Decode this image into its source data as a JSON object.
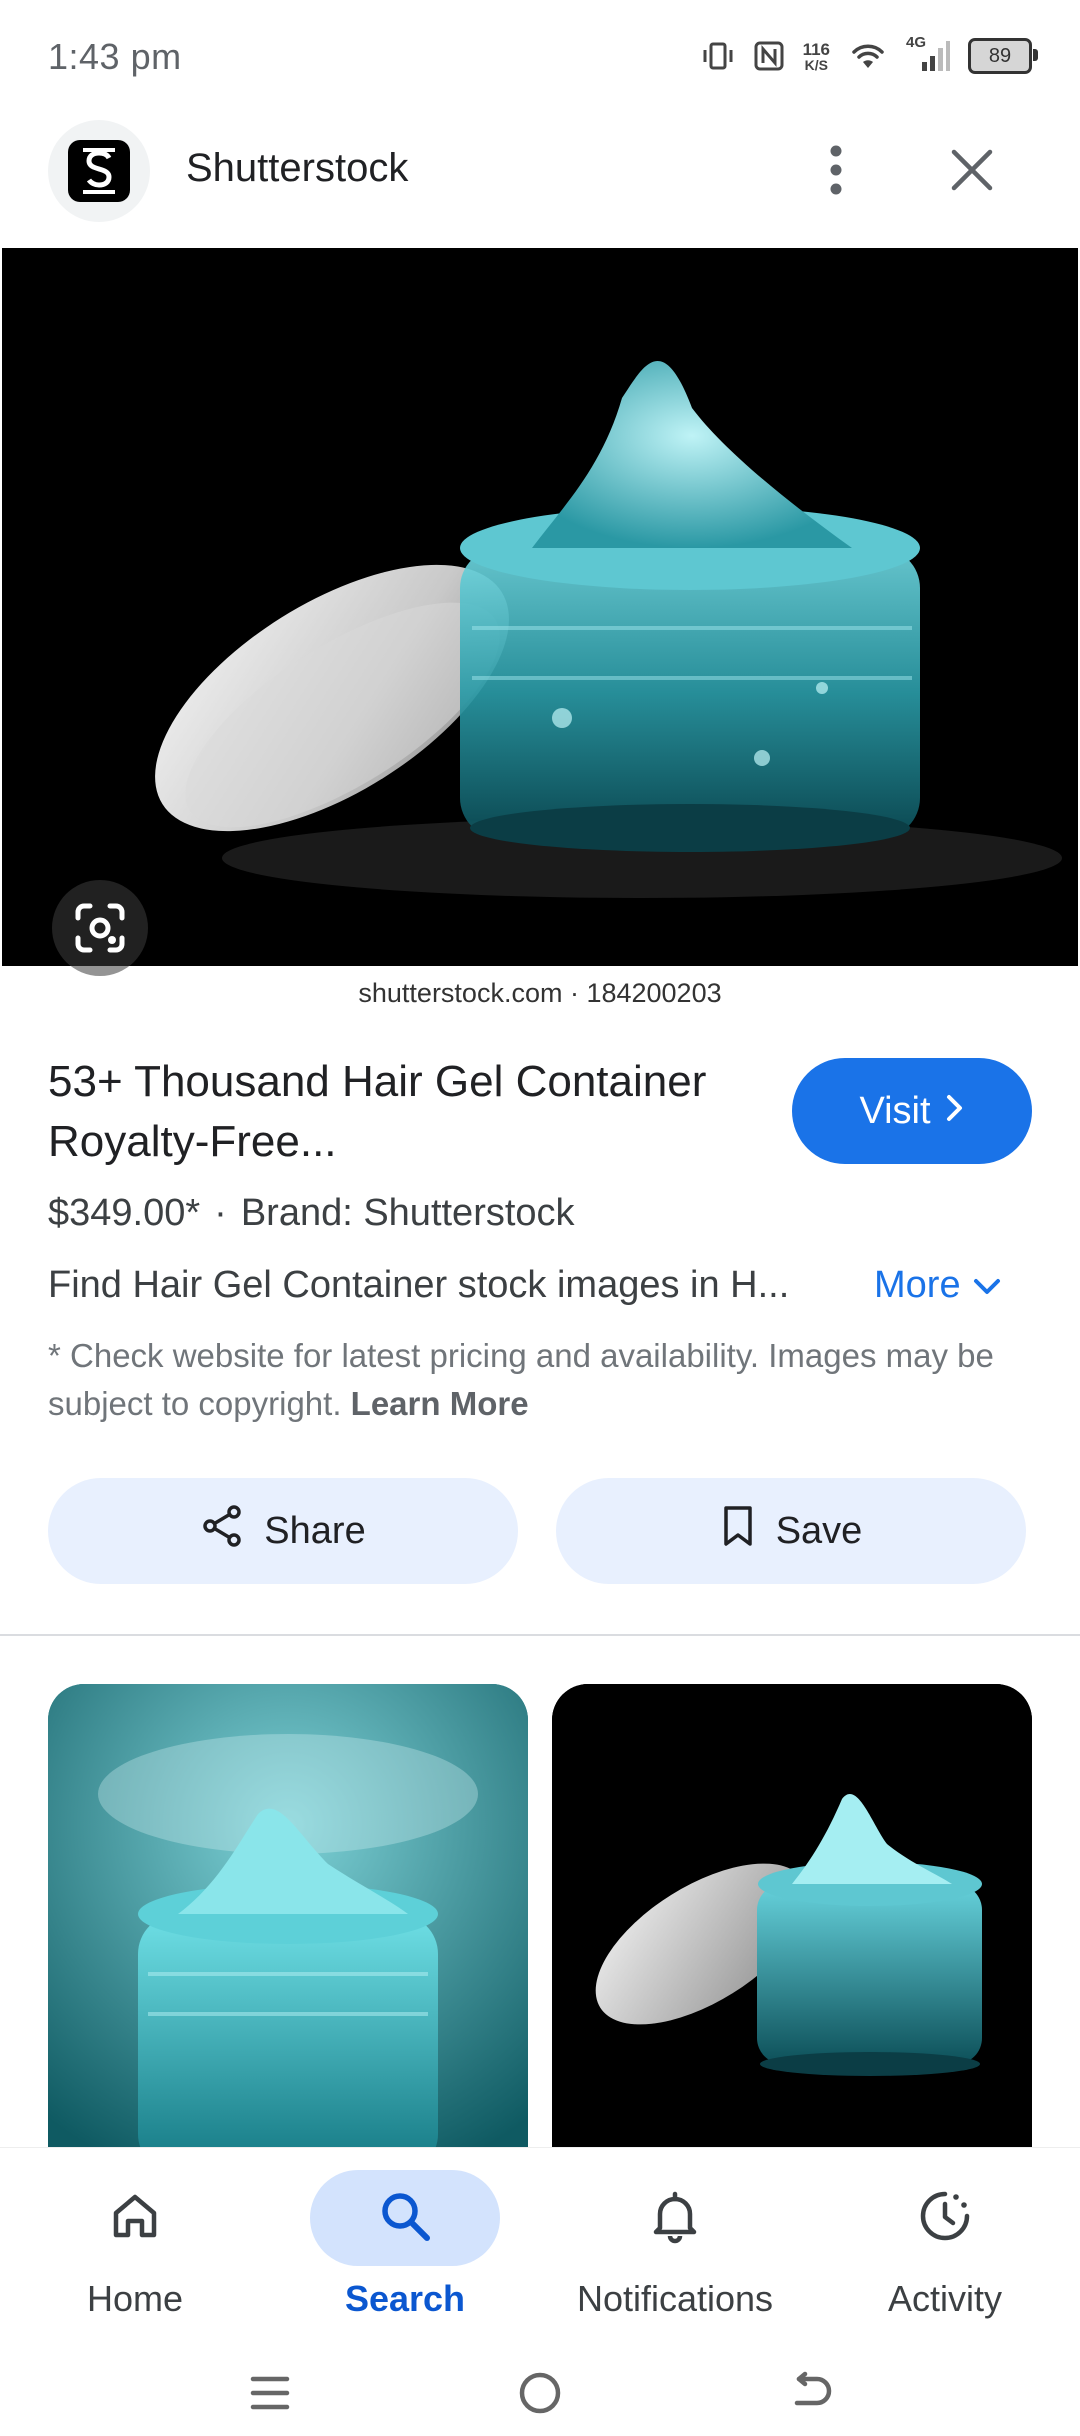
{
  "status_bar": {
    "time": "1:43 pm",
    "net_speed_value": "116",
    "net_speed_unit": "K/S",
    "network_type": "4G",
    "battery": "89"
  },
  "header": {
    "site_name": "Shutterstock"
  },
  "hero": {
    "caption": "shutterstock.com · 184200203"
  },
  "result": {
    "title": "53+ Thousand Hair Gel Container Royalty-Free...",
    "visit_label": "Visit",
    "price": "$349.00*",
    "separator": "·",
    "brand": "Brand: Shutterstock",
    "description": "Find Hair Gel Container stock images in H...",
    "more_label": "More",
    "disclaimer": "* Check website for latest pricing and availability. Images may be subject to copyright.",
    "learn_more": "Learn More",
    "share_label": "Share",
    "save_label": "Save"
  },
  "bottom_nav": {
    "items": [
      {
        "label": "Home",
        "icon": "home-icon"
      },
      {
        "label": "Search",
        "icon": "search-icon",
        "active": true
      },
      {
        "label": "Notifications",
        "icon": "bell-icon"
      },
      {
        "label": "Activity",
        "icon": "activity-icon"
      }
    ]
  },
  "colors": {
    "accent": "#1a73e8",
    "chip_bg": "#e8f0fe",
    "active_nav_bg": "#d3e3fd",
    "gel": "#3fb8c4"
  }
}
